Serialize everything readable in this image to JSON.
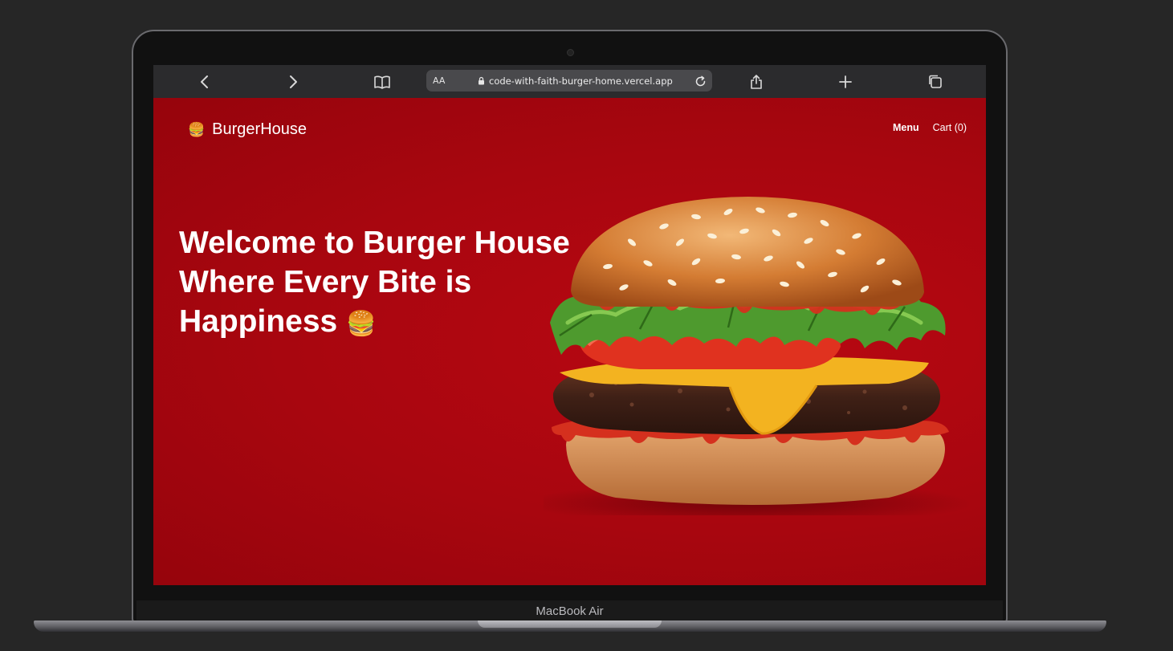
{
  "device": {
    "label": "MacBook Air"
  },
  "browser": {
    "text_size_label": "AA",
    "url": "code-with-faith-burger-home.vercel.app",
    "icons": [
      "back-icon",
      "forward-icon",
      "bookmarks-icon",
      "lock-icon",
      "reload-icon",
      "share-icon",
      "new-tab-icon",
      "tabs-icon"
    ]
  },
  "site": {
    "logo_emoji": "🍔",
    "logo_text": "BurgerHouse",
    "nav": {
      "menu": "Menu",
      "cart": "Cart (0)"
    },
    "hero": {
      "line1": "Welcome to Burger House",
      "line2": "Where Every Bite is",
      "line3": "Happiness",
      "emoji": "🍔"
    },
    "colors": {
      "brand_red": "#ab0710",
      "toolbar": "#2b2b2d",
      "address_bar": "#49494c"
    }
  }
}
